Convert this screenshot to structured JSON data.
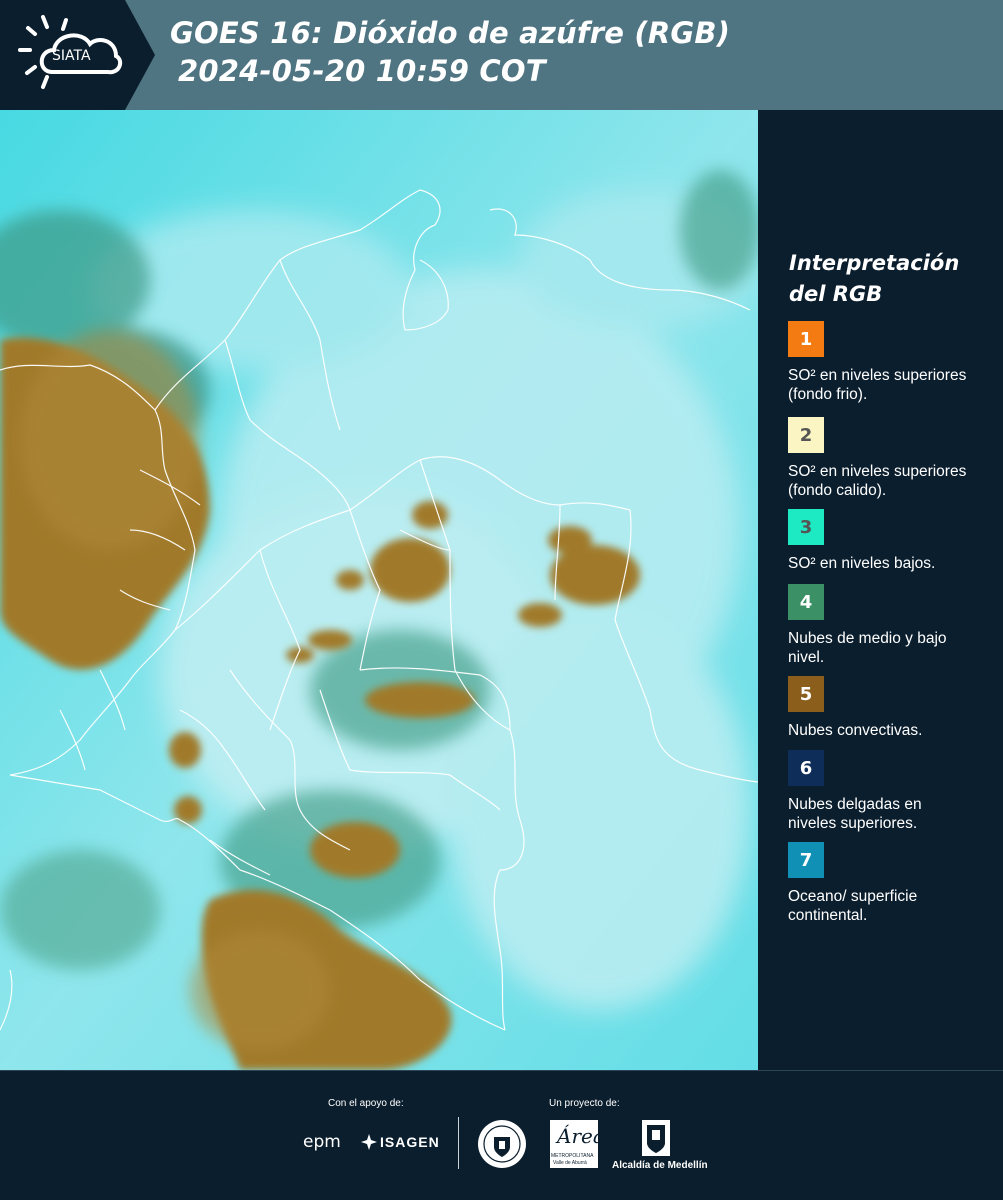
{
  "header": {
    "logo_text": "SIATA",
    "title_line1": "GOES 16: Dióxido de azúfre (RGB)",
    "title_line2": "2024-05-20 10:59 COT"
  },
  "legend": {
    "title": "Interpretación del RGB",
    "items": [
      {
        "num": "1",
        "label": "SO² en niveles superiores (fondo frio).",
        "color": "#f47b12",
        "text_color": "#ffffff"
      },
      {
        "num": "2",
        "label": "SO² en niveles superiores (fondo calido).",
        "color": "#fbf5c4",
        "text_color": "#555555"
      },
      {
        "num": "3",
        "label": "SO² en niveles bajos.",
        "color": "#1de9c3",
        "text_color": "#555555"
      },
      {
        "num": "4",
        "label": "Nubes de medio y bajo nivel.",
        "color": "#3b9165",
        "text_color": "#ffffff"
      },
      {
        "num": "5",
        "label": "Nubes convectivas.",
        "color": "#8b5e1c",
        "text_color": "#ffffff"
      },
      {
        "num": "6",
        "label": "Nubes delgadas en niveles superiores.",
        "color": "#0e2d58",
        "text_color": "#ffffff"
      },
      {
        "num": "7",
        "label": "Oceano/ superficie continental.",
        "color": "#1190b6",
        "text_color": "#ffffff"
      }
    ]
  },
  "footer": {
    "support_label": "Con el apoyo de:",
    "project_label": "Un proyecto de:",
    "epm": "epm",
    "isagen": "ISAGEN",
    "area_text": "Área",
    "area_sub1": "METROPOLITANA",
    "area_sub2": "Valle de Aburrá",
    "alcaldia": "Alcaldía de Medellín"
  },
  "colors": {
    "header_bg": "#4f7482",
    "panel_bg": "#0b1e2d",
    "ocean": "#3fd6df",
    "convective": "#9a7427"
  }
}
